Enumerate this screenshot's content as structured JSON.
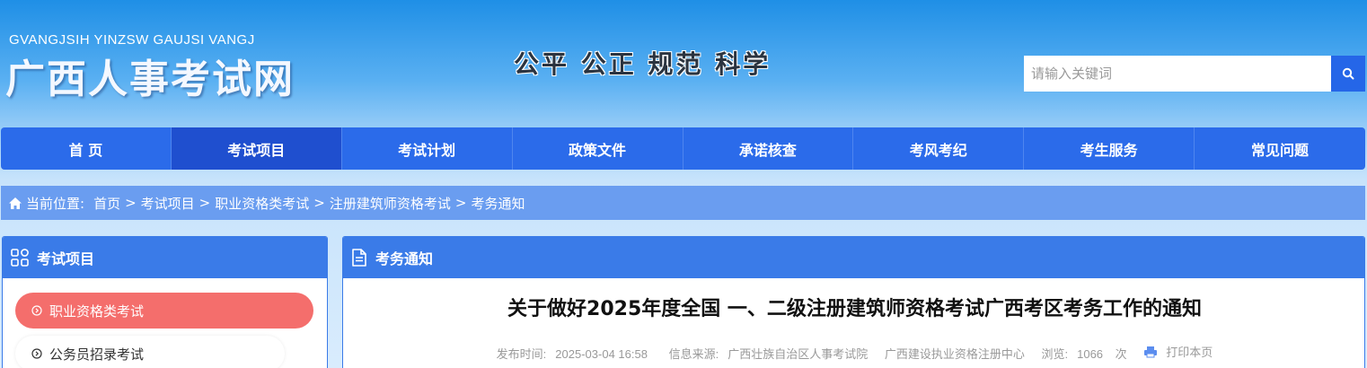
{
  "header": {
    "logo_en": "GVANGJSIH YINZSW GAUJSI VANGJ",
    "logo_cn": "广西人事考试网",
    "slogan": "公平  公正  规范  科学",
    "search_placeholder": "请输入关键词",
    "search_icon": "search-icon"
  },
  "nav": {
    "items": [
      {
        "label": "首 页"
      },
      {
        "label": "考试项目"
      },
      {
        "label": "考试计划"
      },
      {
        "label": "政策文件"
      },
      {
        "label": "承诺核查"
      },
      {
        "label": "考风考纪"
      },
      {
        "label": "考生服务"
      },
      {
        "label": "常见问题"
      }
    ],
    "active_index": 1
  },
  "breadcrumb": {
    "prefix": "当前位置:",
    "items": [
      "首页",
      "考试项目",
      "职业资格类考试",
      "注册建筑师资格考试",
      "考务通知"
    ],
    "separator": ">"
  },
  "sidebar": {
    "title": "考试项目",
    "items": [
      {
        "label": "职业资格类考试"
      },
      {
        "label": "公务员招录考试"
      }
    ]
  },
  "main": {
    "section_title": "考务通知",
    "article_title": "关于做好2025年度全国 一、二级注册建筑师资格考试广西考区考务工作的通知",
    "meta": {
      "publish_label": "发布时间:",
      "publish_time": "2025-03-04 16:58",
      "source_label": "信息来源:",
      "source_1": "广西壮族自治区人事考试院",
      "source_2": "广西建设执业资格注册中心",
      "views_label": "浏览:",
      "views": "1066",
      "views_unit": "次",
      "print_label": "打印本页"
    }
  },
  "colors": {
    "nav_bg": "#2b6bea",
    "nav_active": "#1f4fcf",
    "panel_head": "#3a7be8",
    "menu_active": "#f46e6c",
    "breadcrumb_bg": "#6a9df0"
  }
}
